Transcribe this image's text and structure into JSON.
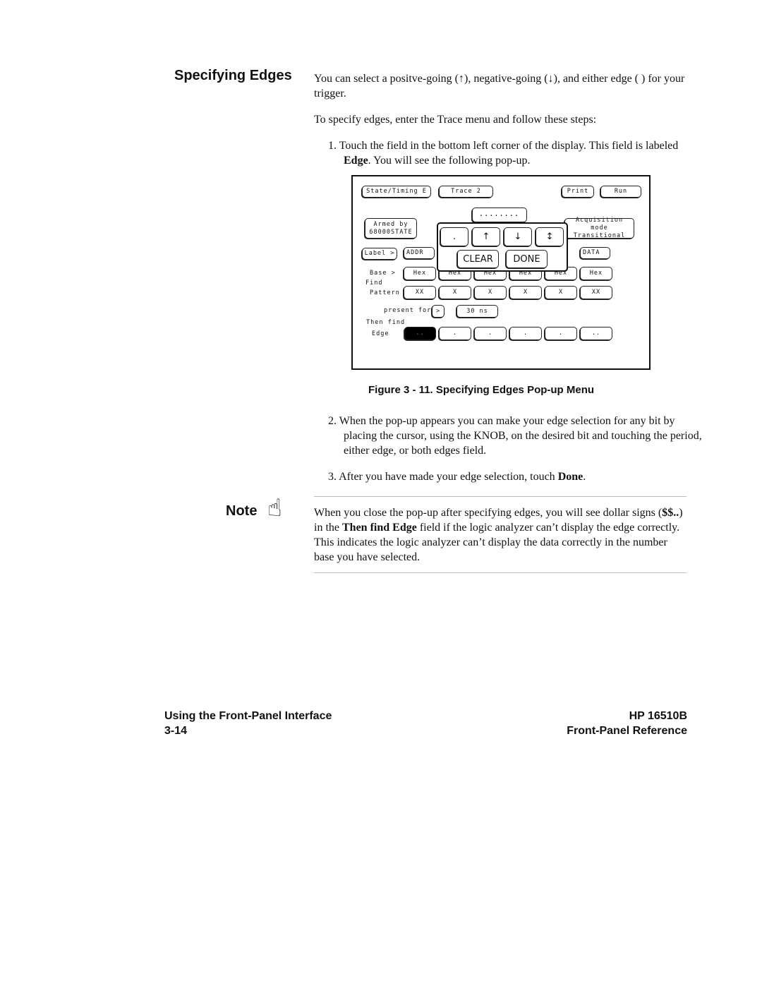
{
  "section_title": "Specifying Edges",
  "intro": "You can select a positve-going (↑), negative-going (↓), and either edge (   ) for your trigger.",
  "para2": "To specify edges, enter the Trace menu and follow these steps:",
  "step1": {
    "num": "1.",
    "a": "Touch the field in the bottom left corner of the display. This field is labeled ",
    "b": "Edge",
    "c": ". You will see the following pop-up."
  },
  "figure": {
    "top_buttons": [
      "State/Timing E",
      "Trace 2",
      "Print",
      "Run"
    ],
    "dots_field": "........",
    "armed_by": [
      "Armed by",
      "68000STATE"
    ],
    "acq_mode": [
      "Acquisition mode",
      "Transitional"
    ],
    "label_btn": "Label >",
    "labels": [
      "ADDR",
      "DATA"
    ],
    "base_label": "Base >",
    "base_values": [
      "Hex",
      "Hex",
      "Hex",
      "Hex",
      "Hex",
      "Hex"
    ],
    "find_label": "Find",
    "pattern_label": "Pattern",
    "pattern_values": [
      "XX",
      "X",
      "X",
      "X",
      "X",
      "XX"
    ],
    "present_for": "present for",
    "present_op": ">",
    "duration": "30 ns",
    "then_find": "Then find",
    "edge_label": "Edge",
    "edge_values": [
      "..",
      ".",
      ".",
      ".",
      ".",
      ".."
    ],
    "popup": {
      "options": [
        ".",
        "↑",
        "↓",
        "↕"
      ],
      "clear": "CLEAR",
      "done": "DONE"
    }
  },
  "caption": "Figure 3 - 11. Specifying Edges Pop-up Menu",
  "step2": {
    "num": "2.",
    "text": "When the pop-up appears you can make your edge selection for any bit by placing the cursor, using the KNOB, on the desired bit and touching the period, either edge, or both edges field."
  },
  "step3": {
    "num": "3.",
    "a": "After you have made your edge selection, touch ",
    "b": "Done",
    "c": "."
  },
  "note": {
    "label": "Note",
    "icon": "pointing-hand-icon",
    "a": "When you close the pop-up after specifying edges, you will see dollar signs (",
    "b": "$$..",
    "c": ") in the ",
    "d": "Then find Edge",
    "e": " field if the logic analyzer can’t display the edge correctly. This indicates the logic analyzer can’t display the data correctly in the number base you have selected."
  },
  "footer": {
    "left_title": "Using the Front-Panel Interface",
    "page_num": "3-14",
    "right_title": "HP 16510B",
    "right_sub": "Front-Panel Reference"
  }
}
